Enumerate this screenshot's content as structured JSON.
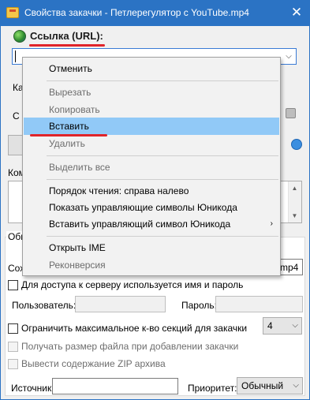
{
  "window": {
    "title": "Свойства закачки - Петлерегулятор с YouTube.mp4",
    "close_glyph": "✕"
  },
  "url_section": {
    "label": "Ссылка (URL):",
    "value": ""
  },
  "background": {
    "partial_ka": "Ка",
    "partial_c": "С",
    "partial_kom": "Ком",
    "tab_label": "Общ",
    "save_as_partial": "Сох",
    "save_as_value": "mp4"
  },
  "options": {
    "server_auth_label": "Для доступа к серверу используется имя и пароль",
    "user_label": "Пользователь:",
    "password_label": "Пароль:",
    "limit_sections_label": "Ограничить максимальное к-во секций для закачки",
    "sections_value": "4",
    "get_size_label": "Получать размер файла при добавлении закачки",
    "zip_label": "Вывести содержание ZIP архива",
    "source_label": "Источник:",
    "priority_label": "Приоритет:",
    "priority_value": "Обычный"
  },
  "context_menu": {
    "items": [
      {
        "label": "Отменить",
        "enabled": true
      },
      {
        "label": "Вырезать",
        "enabled": false
      },
      {
        "label": "Копировать",
        "enabled": false
      },
      {
        "label": "Вставить",
        "enabled": true,
        "highlighted": true
      },
      {
        "label": "Удалить",
        "enabled": false
      },
      {
        "label": "Выделить все",
        "enabled": false
      },
      {
        "label": "Порядок чтения: справа налево",
        "enabled": true
      },
      {
        "label": "Показать управляющие символы Юникода",
        "enabled": true
      },
      {
        "label": "Вставить управляющий символ Юникода",
        "enabled": true,
        "submenu": true
      },
      {
        "label": "Открыть IME",
        "enabled": true
      },
      {
        "label": "Реконверсия",
        "enabled": false
      }
    ],
    "submenu_glyph": "›"
  },
  "colors": {
    "titlebar": "#2b73c4",
    "highlight": "#91c9f7",
    "annotation_red": "#e0242a"
  },
  "icons": {
    "app": "app-folder-icon",
    "url": "globe-icon",
    "dropdown": "chevron-down-icon",
    "close": "close-icon"
  }
}
